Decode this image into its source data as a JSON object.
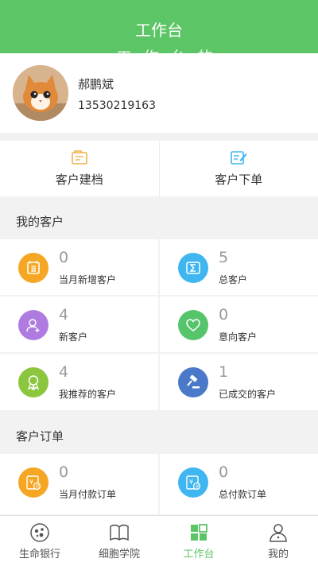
{
  "header": {
    "title": "工作台",
    "ghost_text": "工作台的"
  },
  "profile": {
    "name": "郝鹏斌",
    "phone": "13530219163"
  },
  "actions": [
    {
      "label": "客户建档",
      "icon": "archive-icon"
    },
    {
      "label": "客户下单",
      "icon": "order-edit-icon"
    }
  ],
  "customers": {
    "section_title": "我的客户",
    "items": [
      {
        "value": "0",
        "label": "当月新增客户",
        "icon": "calendar-month-icon",
        "color": "#f5a623"
      },
      {
        "value": "5",
        "label": "总客户",
        "icon": "sum-icon",
        "color": "#3fb6f0"
      },
      {
        "value": "4",
        "label": "新客户",
        "icon": "add-user-icon",
        "color": "#b07be0"
      },
      {
        "value": "0",
        "label": "意向客户",
        "icon": "heart-icon",
        "color": "#55c46a"
      },
      {
        "value": "4",
        "label": "我推荐的客户",
        "icon": "ribbon-icon",
        "color": "#8cc63f"
      },
      {
        "value": "1",
        "label": "已成交的客户",
        "icon": "gavel-icon",
        "color": "#4a79c9"
      }
    ]
  },
  "orders": {
    "section_title": "客户订单",
    "items": [
      {
        "value": "0",
        "label": "当月付款订单",
        "icon": "monthly-payment-icon",
        "color": "#f5a623"
      },
      {
        "value": "0",
        "label": "总付款订单",
        "icon": "total-payment-icon",
        "color": "#3fb6f0"
      }
    ]
  },
  "tabbar": [
    {
      "label": "生命银行",
      "icon": "life-bank-icon",
      "active": false
    },
    {
      "label": "细胞学院",
      "icon": "book-icon",
      "active": false
    },
    {
      "label": "工作台",
      "icon": "grid-icon",
      "active": true
    },
    {
      "label": "我的",
      "icon": "user-icon",
      "active": false
    }
  ],
  "colors": {
    "brand_green": "#5cc565"
  }
}
